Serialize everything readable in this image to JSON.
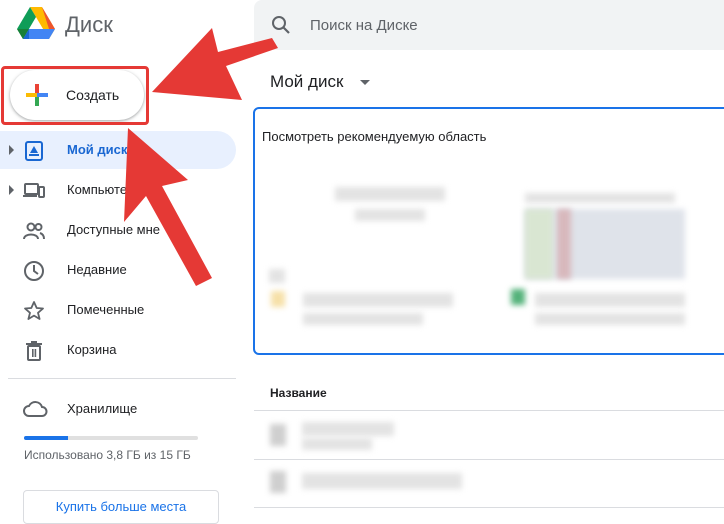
{
  "app": {
    "name": "Диск"
  },
  "create_button": {
    "label": "Создать"
  },
  "nav": {
    "items": [
      {
        "label": "Мой диск",
        "icon": "my-drive-icon",
        "active": true,
        "expandable": true
      },
      {
        "label": "Компьютеры",
        "icon": "computers-icon",
        "active": false,
        "expandable": true
      },
      {
        "label": "Доступные мне",
        "icon": "shared-with-me-icon",
        "active": false,
        "expandable": false
      },
      {
        "label": "Недавние",
        "icon": "recent-icon",
        "active": false,
        "expandable": false
      },
      {
        "label": "Помеченные",
        "icon": "starred-icon",
        "active": false,
        "expandable": false
      },
      {
        "label": "Корзина",
        "icon": "trash-icon",
        "active": false,
        "expandable": false
      }
    ]
  },
  "storage": {
    "title": "Хранилище",
    "used_text": "Использовано 3,8 ГБ из 15 ГБ",
    "used_fraction": 0.25,
    "buy_label": "Купить больше места"
  },
  "search": {
    "placeholder": "Поиск на Диске"
  },
  "main": {
    "title": "Мой диск",
    "suggested_title": "Посмотреть рекомендуемую область",
    "list_header": "Название"
  },
  "colors": {
    "accent": "#1a73e8",
    "active_bg": "#e8f0fe",
    "annotation": "#e53935"
  }
}
